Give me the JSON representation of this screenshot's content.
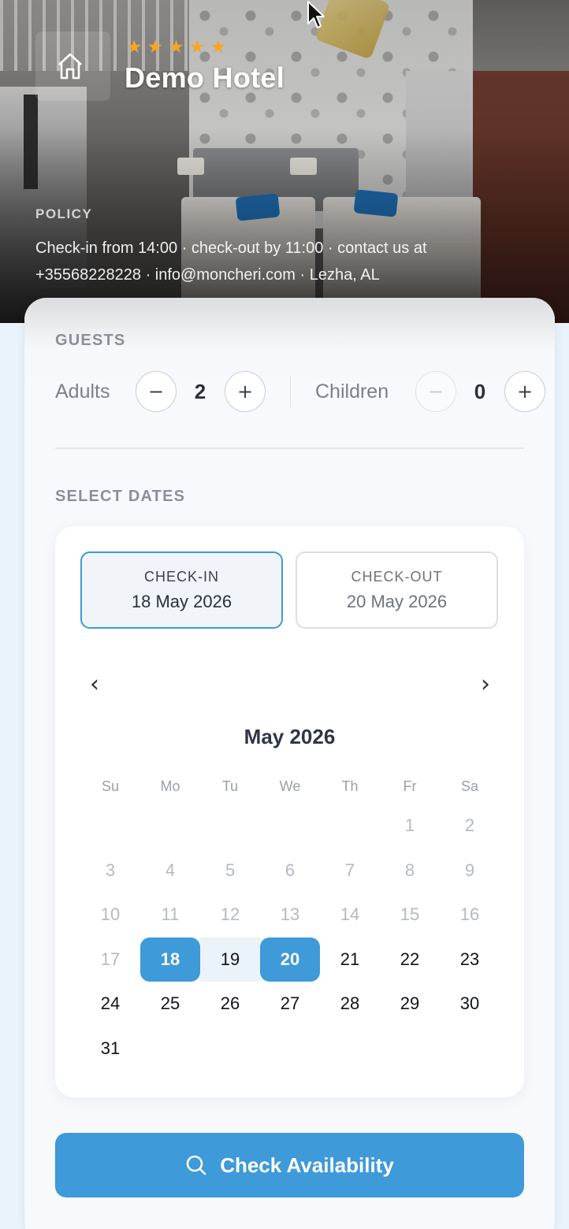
{
  "hotel": {
    "name": "Demo Hotel",
    "stars": 5
  },
  "policy": {
    "label": "POLICY",
    "line1": "Check-in from 14:00 · check-out by 11:00 · contact us at",
    "line2": "+35568228228 · info@moncheri.com · Lezha, AL"
  },
  "guests": {
    "label": "GUESTS",
    "adults_label": "Adults",
    "adults_count": "2",
    "children_label": "Children",
    "children_count": "0",
    "minus": "−",
    "plus": "+"
  },
  "dates": {
    "label": "SELECT DATES",
    "check_in_label": "CHECK-IN",
    "check_in_value": "18 May 2026",
    "check_out_label": "CHECK-OUT",
    "check_out_value": "20 May 2026",
    "prev": "‹",
    "next": "›",
    "month_title": "May 2026",
    "weekdays": [
      "Su",
      "Mo",
      "Tu",
      "We",
      "Th",
      "Fr",
      "Sa"
    ],
    "days": [
      {
        "n": "",
        "state": "blank"
      },
      {
        "n": "",
        "state": "blank"
      },
      {
        "n": "",
        "state": "blank"
      },
      {
        "n": "",
        "state": "blank"
      },
      {
        "n": "",
        "state": "blank"
      },
      {
        "n": "1",
        "state": "past"
      },
      {
        "n": "2",
        "state": "past"
      },
      {
        "n": "3",
        "state": "past"
      },
      {
        "n": "4",
        "state": "past"
      },
      {
        "n": "5",
        "state": "past"
      },
      {
        "n": "6",
        "state": "past"
      },
      {
        "n": "7",
        "state": "past"
      },
      {
        "n": "8",
        "state": "past"
      },
      {
        "n": "9",
        "state": "past"
      },
      {
        "n": "10",
        "state": "past"
      },
      {
        "n": "11",
        "state": "past"
      },
      {
        "n": "12",
        "state": "past"
      },
      {
        "n": "13",
        "state": "past"
      },
      {
        "n": "14",
        "state": "past"
      },
      {
        "n": "15",
        "state": "past"
      },
      {
        "n": "16",
        "state": "past"
      },
      {
        "n": "17",
        "state": "past"
      },
      {
        "n": "18",
        "state": "selected"
      },
      {
        "n": "19",
        "state": "in-range"
      },
      {
        "n": "20",
        "state": "selected"
      },
      {
        "n": "21",
        "state": "normal"
      },
      {
        "n": "22",
        "state": "normal"
      },
      {
        "n": "23",
        "state": "normal"
      },
      {
        "n": "24",
        "state": "normal"
      },
      {
        "n": "25",
        "state": "normal"
      },
      {
        "n": "26",
        "state": "normal"
      },
      {
        "n": "27",
        "state": "normal"
      },
      {
        "n": "28",
        "state": "normal"
      },
      {
        "n": "29",
        "state": "normal"
      },
      {
        "n": "30",
        "state": "normal"
      },
      {
        "n": "31",
        "state": "normal"
      }
    ]
  },
  "cta": {
    "label": "Check Availability",
    "icon": "search-icon"
  },
  "colors": {
    "accent": "#3e9ad8",
    "star": "#f5a623",
    "range": "#eaf2fa"
  }
}
